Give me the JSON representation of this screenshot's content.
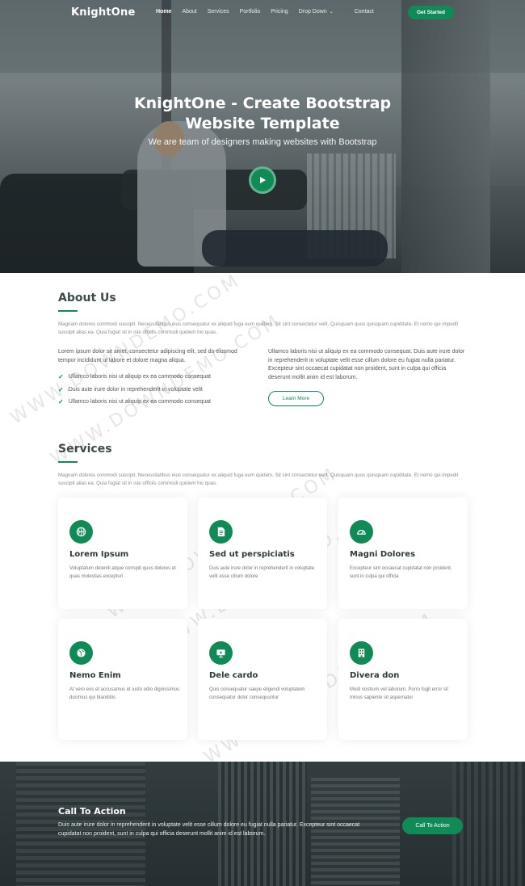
{
  "nav": {
    "logo": "KnightOne",
    "items": [
      {
        "label": "Home"
      },
      {
        "label": "About"
      },
      {
        "label": "Services"
      },
      {
        "label": "Portfolio"
      },
      {
        "label": "Pricing"
      },
      {
        "label": "Drop Down"
      },
      {
        "label": "Contact"
      }
    ],
    "cta": "Get Started"
  },
  "hero": {
    "title_line1": "KnightOne - Create Bootstrap",
    "title_line2": "Website Template",
    "subtitle": "We are team of designers making websites with Bootstrap"
  },
  "about": {
    "title": "About Us",
    "intro": "Magnam dolores commodi suscipit. Necessitatibus eius consequatur ex aliquid fuga eum quidem. Sit sint consectetur velit. Quisquam quos quisquam cupiditate. Et nemo qui impedit suscipit alias ea. Quia fugiat sit in iste officiis commodi quidem hic quas.",
    "left_text": "Lorem ipsum dolor sit amet, consectetur adipiscing elit, sed do eiusmod tempor incididunt ut labore et dolore magna aliqua.",
    "checks": [
      "Ullamco laboris nisi ut aliquip ex ea commodo consequat",
      "Duis aute irure dolor in reprehenderit in voluptate velit",
      "Ullamco laboris nisi ut aliquip ex ea commodo consequat"
    ],
    "right_text": "Ullamco laboris nisi ut aliquip ex ea commodo consequat. Duis aute irure dolor in reprehenderit in voluptate velit esse cillum dolore eu fugiat nulla pariatur. Excepteur sint occaecat cupidatat non proident, sunt in culpa qui officia deserunt mollit anim id est laborum.",
    "learn_more": "Learn More"
  },
  "services": {
    "title": "Services",
    "intro": "Magnam dolores commodi suscipit. Necessitatibus eius consequatur ex aliquid fuga eum quidem. Sit sint consectetur velit. Quisquam quos quisquam cupiditate. Et nemo qui impedit suscipit alias ea. Quia fugiat sit in iste officiis commodi quidem hic quas.",
    "cards": [
      {
        "icon": "basketball-icon",
        "title": "Lorem Ipsum",
        "desc": "Voluptatum deleniti atque corrupti quos dolores et quas molestias excepturi"
      },
      {
        "icon": "document-icon",
        "title": "Sed ut perspiciatis",
        "desc": "Duis aute irure dolor in reprehenderit in voluptate velit esse cillum dolore"
      },
      {
        "icon": "tachometer-icon",
        "title": "Magni Dolores",
        "desc": "Excepteur sint occaecat cupidatat non proident, sunt in culpa qui officia"
      },
      {
        "icon": "globe-icon",
        "title": "Nemo Enim",
        "desc": "At vero eos et accusamus et iusto odio dignissimos ducimus qui blanditiis"
      },
      {
        "icon": "slideshow-icon",
        "title": "Dele cardo",
        "desc": "Quis consequatur saepe eligendi voluptatem consequatur dolor consequuntur"
      },
      {
        "icon": "building-icon",
        "title": "Divera don",
        "desc": "Modi nostrum vel laborum. Porro fugit error sit minus sapiente sit aspernatur"
      }
    ]
  },
  "cta": {
    "title": "Call To Action",
    "text": "Duis aute irure dolor in reprehenderit in voluptate velit esse cillum dolore eu fugiat nulla pariatur. Excepteur sint occaecat cupidatat non proident, sunt in culpa qui officia deserunt mollit anim id est laborum.",
    "button": "Call To Action"
  },
  "watermark": "WWW.DOWNDEMO.COM",
  "colors": {
    "accent": "#108a57"
  }
}
